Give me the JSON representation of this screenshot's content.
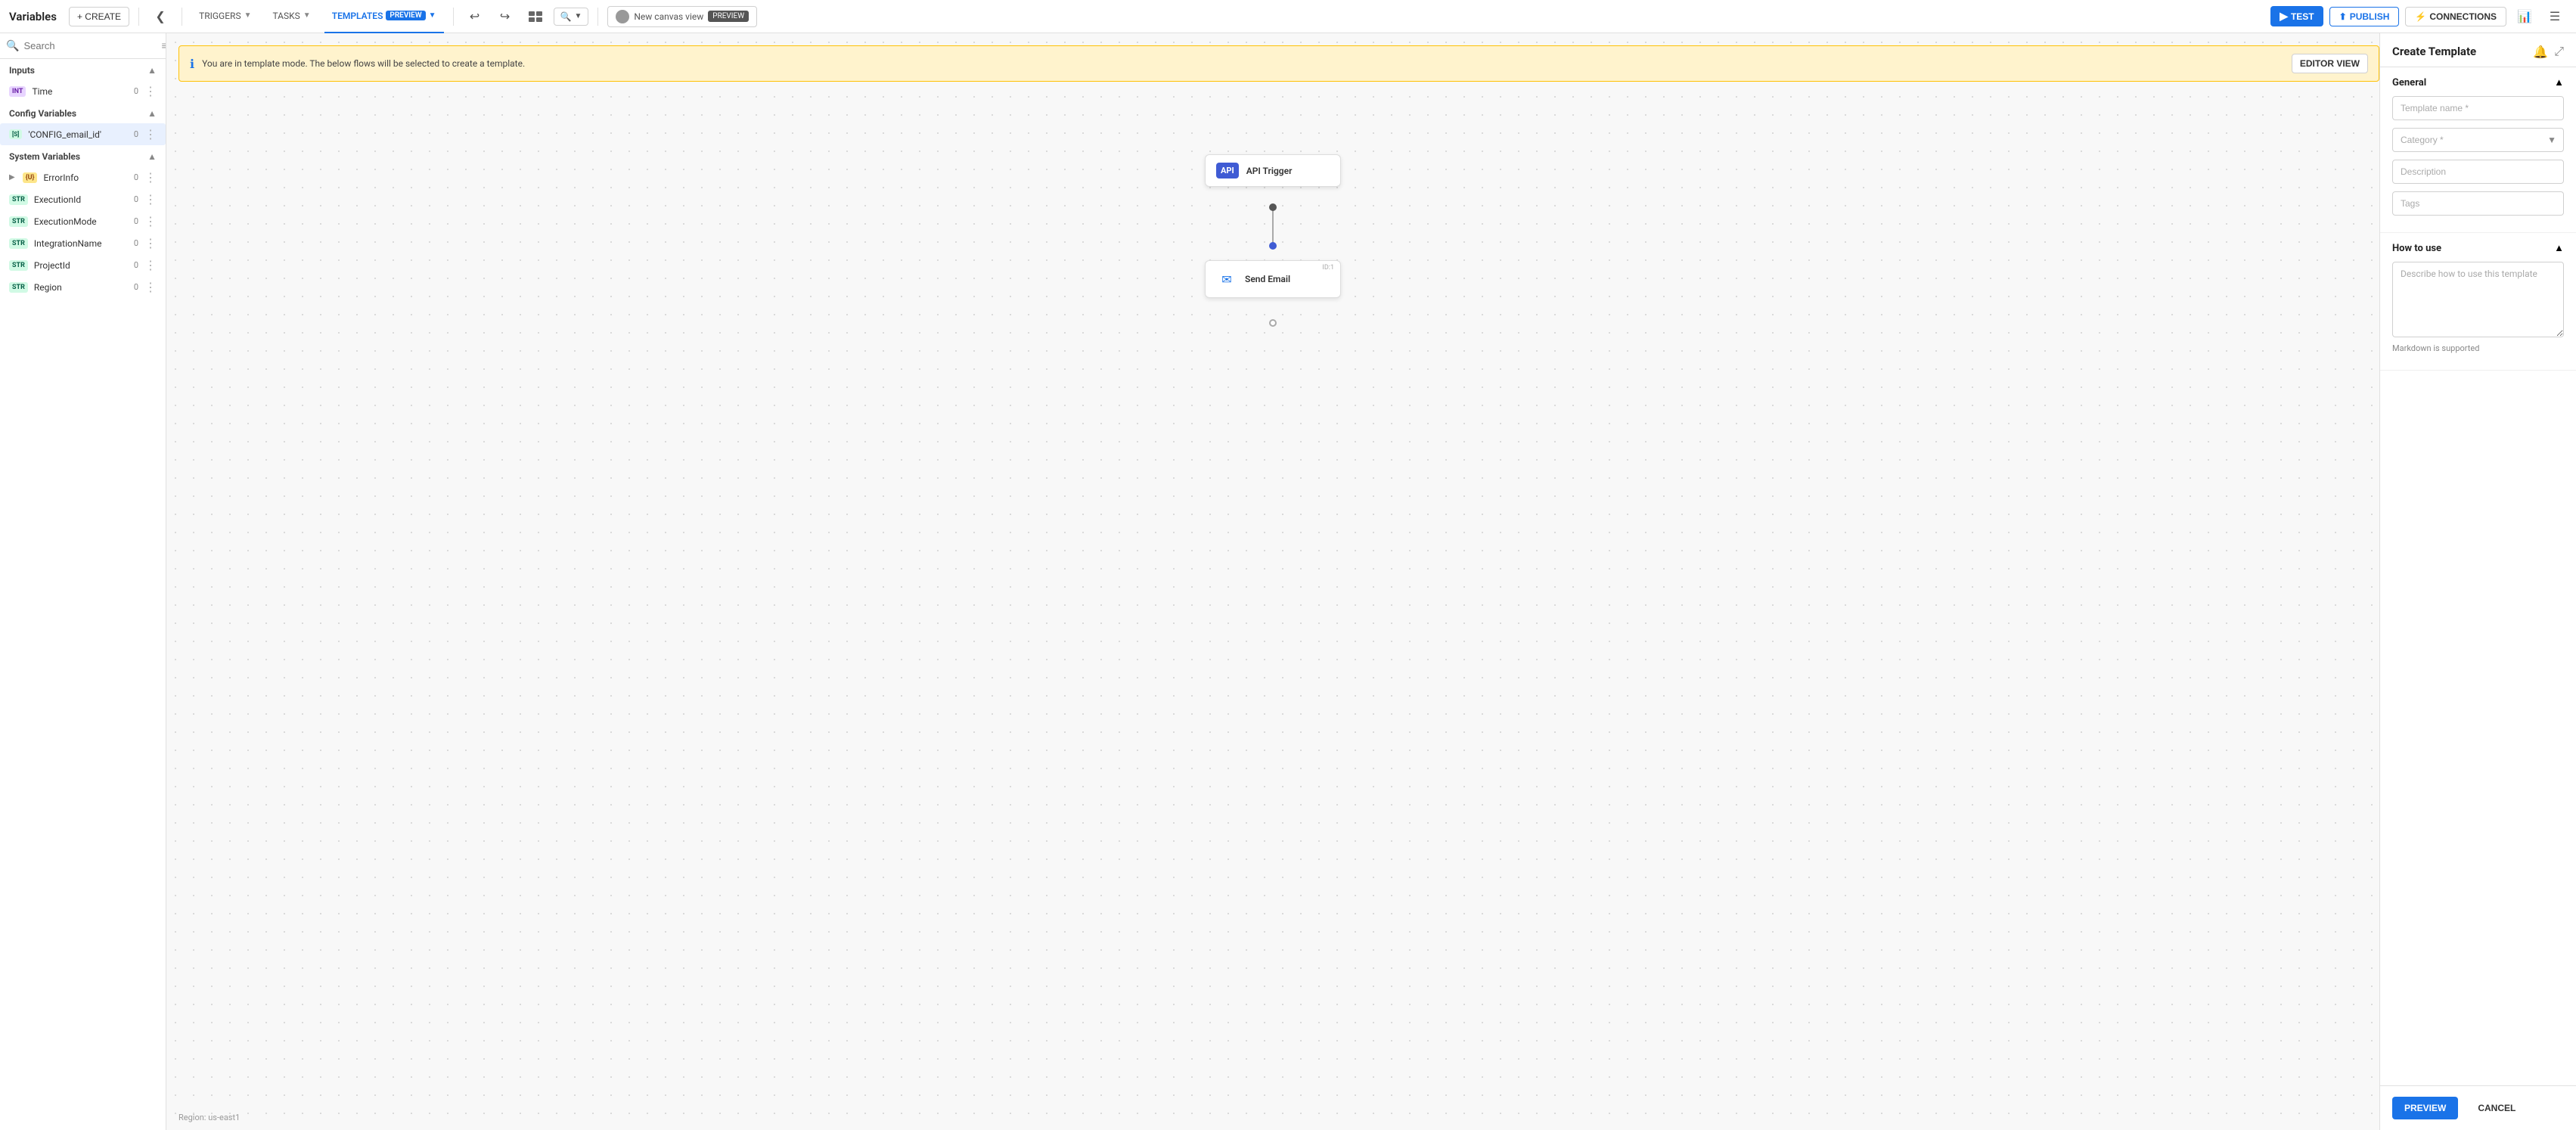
{
  "app": {
    "title": "Variables"
  },
  "topnav": {
    "create_label": "+ CREATE",
    "collapse_icon": "❮",
    "triggers_label": "TRIGGERS",
    "tasks_label": "TASKS",
    "templates_label": "TEMPLATES",
    "templates_badge": "PREVIEW",
    "undo_icon": "↩",
    "redo_icon": "↪",
    "layout_icon": "⊞",
    "zoom_icon": "🔍",
    "canvas_view_label": "New canvas view",
    "canvas_preview_badge": "PREVIEW",
    "test_label": "TEST",
    "publish_label": "PUBLISH",
    "connections_label": "CONNECTIONS",
    "chart_icon": "📊",
    "menu_icon": "☰"
  },
  "sidebar": {
    "search_placeholder": "Search",
    "sections": {
      "inputs": {
        "title": "Inputs",
        "items": [
          {
            "badge": "INT",
            "badge_type": "int",
            "name": "Time",
            "count": "0"
          }
        ]
      },
      "config": {
        "title": "Config Variables",
        "items": [
          {
            "badge": "S",
            "badge_type": "str",
            "name": "'CONFIG_email_id'",
            "count": "0"
          }
        ]
      },
      "system": {
        "title": "System Variables",
        "items": [
          {
            "badge": "U",
            "badge_type": "obj",
            "name": "ErrorInfo",
            "count": "0",
            "expandable": true
          },
          {
            "badge": "STR",
            "badge_type": "str",
            "name": "ExecutionId",
            "count": "0"
          },
          {
            "badge": "STR",
            "badge_type": "str",
            "name": "ExecutionMode",
            "count": "0"
          },
          {
            "badge": "STR",
            "badge_type": "str",
            "name": "IntegrationName",
            "count": "0"
          },
          {
            "badge": "STR",
            "badge_type": "str",
            "name": "ProjectId",
            "count": "0"
          },
          {
            "badge": "STR",
            "badge_type": "str",
            "name": "Region",
            "count": "0"
          }
        ]
      }
    }
  },
  "canvas": {
    "banner_text": "You are in template mode. The below flows will be selected to create a template.",
    "editor_view_btn": "EDITOR VIEW",
    "region_label": "Region: us-east1",
    "nodes": {
      "api_trigger": {
        "label": "API Trigger",
        "icon": "API"
      },
      "send_email": {
        "label": "Send Email",
        "id": "ID:1",
        "icon": "✉"
      }
    }
  },
  "right_panel": {
    "title": "Create Template",
    "sections": {
      "general": {
        "title": "General",
        "template_name_placeholder": "Template name *",
        "category_placeholder": "Category *",
        "description_placeholder": "Description",
        "tags_placeholder": "Tags"
      },
      "how_to_use": {
        "title": "How to use",
        "textarea_placeholder": "Describe how to use this template",
        "markdown_note": "Markdown is supported"
      }
    },
    "buttons": {
      "preview_label": "PREVIEW",
      "cancel_label": "CANCEL"
    }
  }
}
